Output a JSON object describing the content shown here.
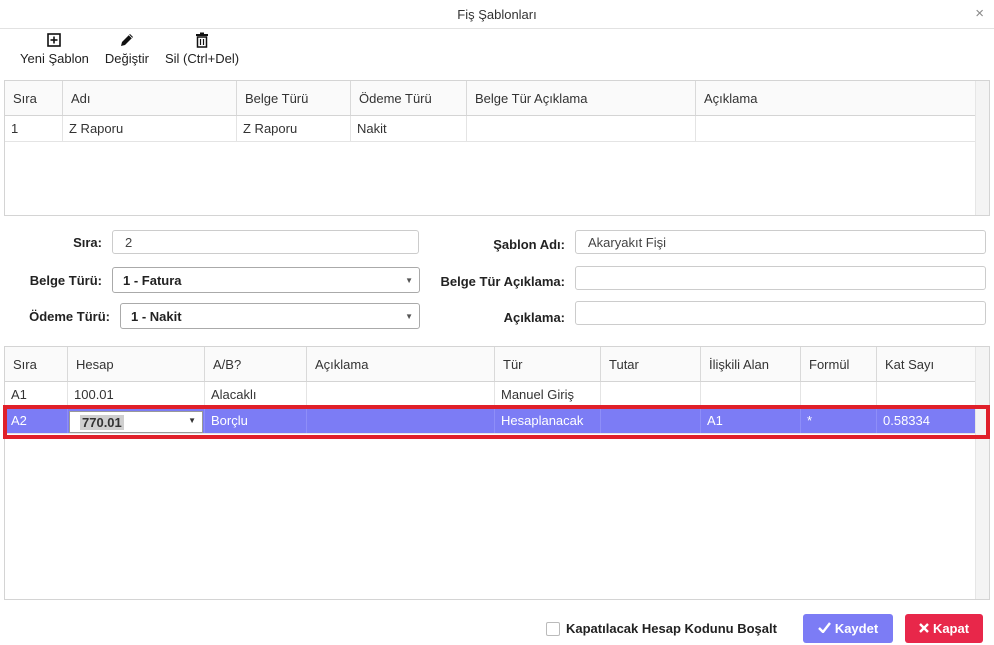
{
  "window": {
    "title": "Fiş Şablonları"
  },
  "toolbar": {
    "new_label": "Yeni Şablon",
    "edit_label": "Değiştir",
    "delete_label": "Sil (Ctrl+Del)"
  },
  "templates_grid": {
    "columns": [
      "Sıra",
      "Adı",
      "Belge Türü",
      "Ödeme Türü",
      "Belge Tür Açıklama",
      "Açıklama"
    ],
    "rows": [
      [
        "1",
        "Z Raporu",
        "Z Raporu",
        "Nakit",
        "",
        ""
      ]
    ]
  },
  "form": {
    "sira_label": "Sıra:",
    "sira_value": "2",
    "belge_turu_label": "Belge Türü:",
    "belge_turu_value": "1 - Fatura",
    "odeme_turu_label": "Ödeme Türü:",
    "odeme_turu_value": "1 - Nakit",
    "sablon_adi_label": "Şablon Adı:",
    "sablon_adi_value": "Akaryakıt Fişi",
    "belge_tur_aciklama_label": "Belge Tür Açıklama:",
    "belge_tur_aciklama_value": "",
    "aciklama_label": "Açıklama:",
    "aciklama_value": ""
  },
  "lines_grid": {
    "columns": [
      "Sıra",
      "Hesap",
      "A/B?",
      "Açıklama",
      "Tür",
      "Tutar",
      "İlişkili Alan",
      "Formül",
      "Kat Sayı"
    ],
    "rows": [
      [
        "A1",
        "100.01",
        "Alacaklı",
        "",
        "Manuel Giriş",
        "",
        "",
        "",
        ""
      ],
      [
        "A2",
        "",
        "Borçlu",
        "",
        "Hesaplanacak",
        "",
        "A1",
        "*",
        "0.58334"
      ]
    ],
    "editing_value": "770.01"
  },
  "footer": {
    "checkbox_label": "Kapatılacak Hesap Kodunu Boşalt",
    "save_label": "Kaydet",
    "close_label": "Kapat"
  },
  "colors": {
    "selected_row": "#7c7cf5",
    "highlight": "#e0202a",
    "close_button": "#e8274a"
  }
}
